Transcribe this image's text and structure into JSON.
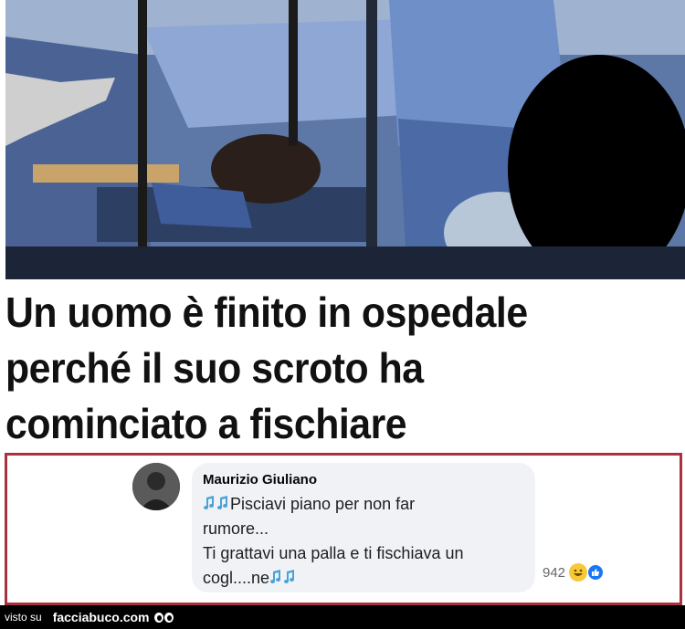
{
  "headline": {
    "line1": "Un uomo è finito in ospedale",
    "line2": "perché il suo scroto ha",
    "line3": "cominciato a fischiare"
  },
  "comment": {
    "author": "Maurizio Giuliano",
    "line1": "Pisciavi piano per non far",
    "line2": "rumore...",
    "line3": "Ti grattavi una palla e ti fischiava un",
    "line4": "cogl....ne",
    "reaction_count": "942",
    "reaction_icons": [
      "laugh-emoji",
      "like-icon"
    ]
  },
  "footer": {
    "visto_su": "visto su",
    "site": "facciabuco.com"
  },
  "colors": {
    "frame_border": "#a8323e",
    "bubble_bg": "#f0f2f5",
    "footer_bg": "#000000"
  }
}
